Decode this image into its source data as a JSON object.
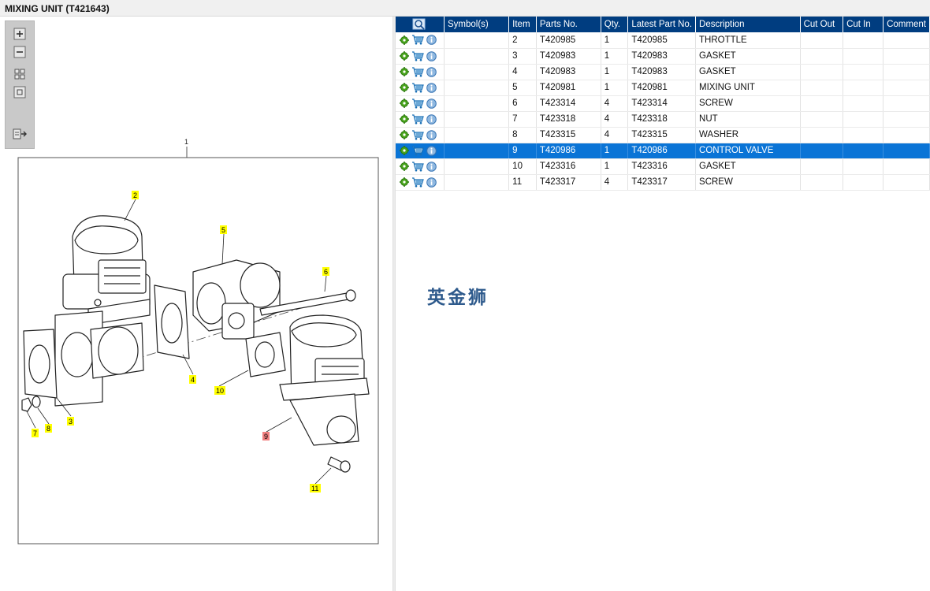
{
  "window": {
    "title": "MIXING UNIT (T421643)"
  },
  "toolbox": {
    "buttons": [
      "zoom-in-icon",
      "zoom-out-icon",
      "fit-grid-icon",
      "actual-size-icon",
      "export-icon"
    ]
  },
  "diagram": {
    "assembly_label": "1",
    "callouts": [
      "2",
      "3",
      "4",
      "5",
      "6",
      "7",
      "8",
      "9",
      "10",
      "11"
    ],
    "callout_color": "#ffff00",
    "highlight_color": "#f08080"
  },
  "table": {
    "columns": [
      "",
      "Symbol(s)",
      "Item",
      "Parts No.",
      "Qty.",
      "Latest Part No.",
      "Description",
      "Cut Out",
      "Cut In",
      "Comment"
    ],
    "header_color": "#003d80",
    "selected_color": "#0a74d6",
    "rows": [
      {
        "item": "2",
        "part": "T420985",
        "qty": "1",
        "latest": "T420985",
        "desc": "THROTTLE"
      },
      {
        "item": "3",
        "part": "T420983",
        "qty": "1",
        "latest": "T420983",
        "desc": "GASKET"
      },
      {
        "item": "4",
        "part": "T420983",
        "qty": "1",
        "latest": "T420983",
        "desc": "GASKET"
      },
      {
        "item": "5",
        "part": "T420981",
        "qty": "1",
        "latest": "T420981",
        "desc": "MIXING UNIT"
      },
      {
        "item": "6",
        "part": "T423314",
        "qty": "4",
        "latest": "T423314",
        "desc": "SCREW"
      },
      {
        "item": "7",
        "part": "T423318",
        "qty": "4",
        "latest": "T423318",
        "desc": "NUT"
      },
      {
        "item": "8",
        "part": "T423315",
        "qty": "4",
        "latest": "T423315",
        "desc": "WASHER"
      },
      {
        "item": "9",
        "part": "T420986",
        "qty": "1",
        "latest": "T420986",
        "desc": "CONTROL VALVE",
        "selected": true
      },
      {
        "item": "10",
        "part": "T423316",
        "qty": "1",
        "latest": "T423316",
        "desc": "GASKET"
      },
      {
        "item": "11",
        "part": "T423317",
        "qty": "4",
        "latest": "T423317",
        "desc": "SCREW"
      }
    ]
  },
  "watermark": {
    "text": "英金狮"
  }
}
